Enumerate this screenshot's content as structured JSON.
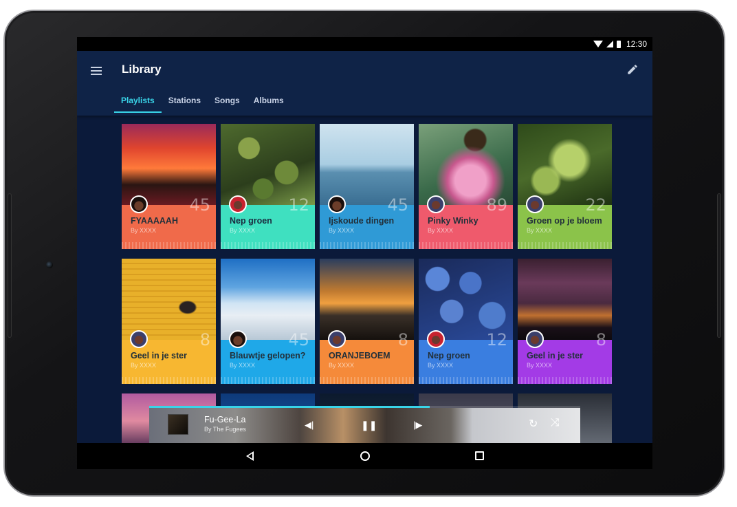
{
  "status_bar": {
    "time": "12:30"
  },
  "app_bar": {
    "title": "Library"
  },
  "tabs": [
    {
      "label": "Playlists",
      "active": true
    },
    {
      "label": "Stations",
      "active": false
    },
    {
      "label": "Songs",
      "active": false
    },
    {
      "label": "Albums",
      "active": false
    }
  ],
  "playlists": [
    {
      "title": "FYAAAAAH",
      "by": "By XXXX",
      "count": "45",
      "color": "#f06a4a"
    },
    {
      "title": "Nep groen",
      "by": "By XXXX",
      "count": "12",
      "color": "#3fe0c0"
    },
    {
      "title": "Ijskoude dingen",
      "by": "By XXXX",
      "count": "45",
      "color": "#2f9ad6"
    },
    {
      "title": "Pinky Winky",
      "by": "By XXXX",
      "count": "89",
      "color": "#ef5a6c"
    },
    {
      "title": "Groen op je bloem",
      "by": "By XXXX",
      "count": "22",
      "color": "#8bc34a"
    },
    {
      "title": "Geel in je ster",
      "by": "By XXXX",
      "count": "8",
      "color": "#f7b731"
    },
    {
      "title": "Blauwtje gelopen?",
      "by": "By XXXX",
      "count": "45",
      "color": "#1fa8e8"
    },
    {
      "title": "ORANJEBOEM",
      "by": "By XXXX",
      "count": "8",
      "color": "#f58a3a"
    },
    {
      "title": "Nep groen",
      "by": "By XXXX",
      "count": "12",
      "color": "#3a7ee0"
    },
    {
      "title": "Geel in je ster",
      "by": "By XXXX",
      "count": "8",
      "color": "#a33be6"
    }
  ],
  "now_playing": {
    "title": "Fu-Gee-La",
    "artist": "By The Fugees",
    "progress": 0.65
  }
}
